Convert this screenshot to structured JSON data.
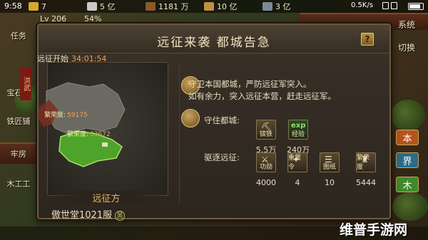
{
  "status": {
    "time": "9:58",
    "network": "0.5K/s"
  },
  "resources": {
    "gold": "7",
    "silver": "5 亿",
    "wood": "1181 万",
    "food": "10 亿",
    "iron": "3 亿"
  },
  "player": {
    "level": "Lv 206",
    "percent": "54%"
  },
  "left_buttons": [
    "任务",
    "宝石商",
    "铁匠铺",
    "牢房",
    "木工工"
  ],
  "right_buttons": [
    "系统",
    "切换"
  ],
  "side_tabs": [
    "本",
    "界",
    "木"
  ],
  "dialog": {
    "title": "远征来袭 都城告急",
    "help": "?",
    "start_label": "远征开始",
    "countdown": "34:01:54",
    "map_seal": "洪武",
    "prosperity_1_label": "繁荣度:",
    "prosperity_1_value": "59175",
    "prosperity_2_label": "繁荣度:",
    "prosperity_2_value": "33672",
    "side_label": "远征方",
    "server": "傲世堂1021服",
    "server_flag": "昊",
    "desc_line1": "守卫本国都城，严防远征军突入。",
    "desc_line2": "如有余力，突入远征本营，赶走远征军。",
    "defend_label": "守住都城:",
    "defend_rewards": [
      {
        "name": "镔铁",
        "qty": "5.5万"
      },
      {
        "name": "经验",
        "badge": "exp",
        "qty": "240万"
      }
    ],
    "expel_label": "驱逐远征:",
    "expel_rewards": [
      {
        "name": "功勋",
        "qty": "4000"
      },
      {
        "name": "重置令",
        "qty": "4"
      },
      {
        "name": "图纸",
        "qty": "10"
      },
      {
        "name": "繁荣度",
        "qty": "5444"
      }
    ]
  },
  "watermark": "维普手游网"
}
